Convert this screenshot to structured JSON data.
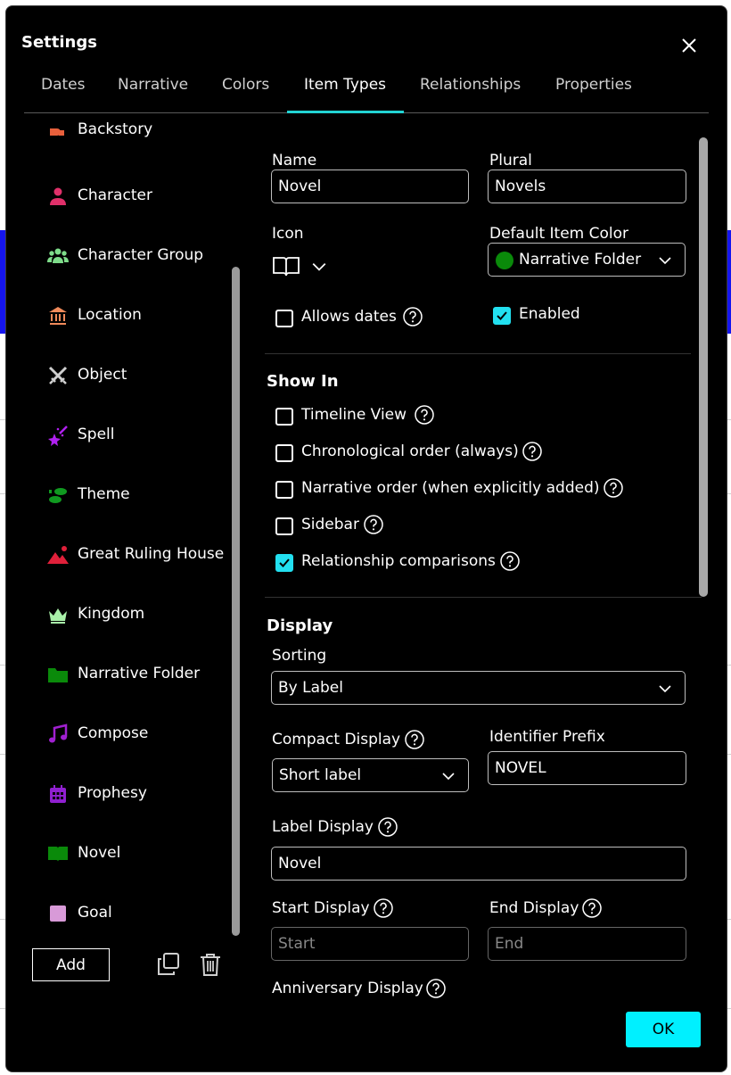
{
  "dialog": {
    "title": "Settings"
  },
  "tabs": [
    {
      "label": "Dates"
    },
    {
      "label": "Narrative"
    },
    {
      "label": "Colors"
    },
    {
      "label": "Item Types",
      "active": true
    },
    {
      "label": "Relationships"
    },
    {
      "label": "Properties"
    }
  ],
  "item_types": [
    {
      "label": "Backstory",
      "icon": "backstory-icon",
      "color": "#e8603c"
    },
    {
      "label": "Character",
      "icon": "person-icon",
      "color": "#e0306a"
    },
    {
      "label": "Character Group",
      "icon": "group-icon",
      "color": "#7edc8a"
    },
    {
      "label": "Location",
      "icon": "bank-icon",
      "color": "#f08a5a"
    },
    {
      "label": "Object",
      "icon": "swords-icon",
      "color": "#cfcfcf"
    },
    {
      "label": "Spell",
      "icon": "magic-wand-icon",
      "color": "#b020f0"
    },
    {
      "label": "Theme",
      "icon": "footprints-icon",
      "color": "#109a20"
    },
    {
      "label": "Great Ruling House",
      "icon": "landscape-icon",
      "color": "#e0203a"
    },
    {
      "label": "Kingdom",
      "icon": "crown-icon",
      "color": "#a8f0a8"
    },
    {
      "label": "Narrative Folder",
      "icon": "folder-icon",
      "color": "#0a8a0a"
    },
    {
      "label": "Compose",
      "icon": "music-note-icon",
      "color": "#a020d0"
    },
    {
      "label": "Prophesy",
      "icon": "calendar-icon",
      "color": "#9020d0"
    },
    {
      "label": "Novel",
      "icon": "open-book-icon",
      "color": "#0a8a0a",
      "selected": true
    },
    {
      "label": "Goal",
      "icon": "square-icon",
      "color": "#d89ad8"
    }
  ],
  "actions": {
    "add_label": "Add",
    "ok_label": "OK"
  },
  "form": {
    "name_label": "Name",
    "name_value": "Novel",
    "plural_label": "Plural",
    "plural_value": "Novels",
    "icon_label": "Icon",
    "icon_value": "open-book-icon",
    "default_color_label": "Default Item Color",
    "default_color_value": "Narrative Folder",
    "default_color_swatch": "#0a8a0a",
    "allows_dates_label": "Allows dates",
    "allows_dates_checked": false,
    "enabled_label": "Enabled",
    "enabled_checked": true
  },
  "show_in": {
    "title": "Show In",
    "items": [
      {
        "label": "Timeline View",
        "checked": false
      },
      {
        "label": "Chronological order (always)",
        "checked": false
      },
      {
        "label": "Narrative order (when explicitly added)",
        "checked": false
      },
      {
        "label": "Sidebar",
        "checked": false
      },
      {
        "label": "Relationship comparisons",
        "checked": true
      }
    ]
  },
  "display": {
    "title": "Display",
    "sorting_label": "Sorting",
    "sorting_value": "By Label",
    "compact_label": "Compact Display",
    "compact_value": "Short label",
    "prefix_label": "Identifier Prefix",
    "prefix_value": "NOVEL",
    "label_display_label": "Label Display",
    "label_display_value": "Novel",
    "start_label": "Start Display",
    "start_placeholder": "Start",
    "end_label": "End Display",
    "end_placeholder": "End",
    "anniversary_label": "Anniversary Display"
  },
  "colors": {
    "accent": "#22d3d3",
    "ok_button": "#00f0ff",
    "checkbox_checked": "#22e0f0",
    "background": "#000000"
  }
}
